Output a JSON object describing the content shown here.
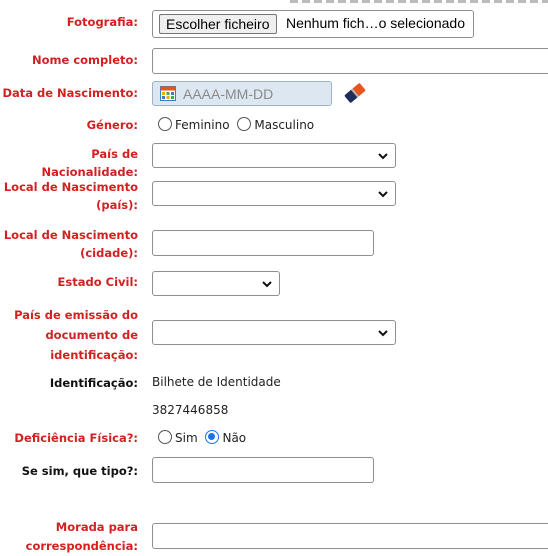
{
  "form": {
    "photo": {
      "label": "Fotografia:",
      "button": "Escolher ficheiro",
      "status": "Nenhum fich…o selecionado"
    },
    "full_name": {
      "label": "Nome completo:",
      "value": ""
    },
    "birth_date": {
      "label": "Data de Nascimento:",
      "placeholder": "AAAA-MM-DD",
      "clear_icon": "eraser-icon"
    },
    "gender": {
      "label": "Género:",
      "options": [
        "Feminino",
        "Masculino"
      ]
    },
    "nationality": {
      "label": "País de Nacionalidade:",
      "value": ""
    },
    "birth_country": {
      "label_line1": "Local de Nascimento",
      "label_line2": "(país):",
      "value": ""
    },
    "birth_city": {
      "label_line1": "Local de Nascimento",
      "label_line2": "(cidade):",
      "value": ""
    },
    "civil_status": {
      "label": "Estado Civil:",
      "value": ""
    },
    "id_country": {
      "label_line1": "País de emissão do",
      "label_line2": "documento de",
      "label_line3": "identificação:",
      "value": ""
    },
    "identification": {
      "label": "Identificação:",
      "type": "Bilhete de Identidade",
      "number": "3827446858"
    },
    "disability": {
      "label": "Deficiência Física?:",
      "options": [
        "Sim",
        "Não"
      ],
      "selected": "Não"
    },
    "disability_type": {
      "label": "Se sim, que tipo?:",
      "value": ""
    },
    "address": {
      "label_line1": "Morada para",
      "label_line2": "correspondência:",
      "value": ""
    }
  },
  "colors": {
    "label_red": "#d42020",
    "accent_blue": "#1a73e8",
    "date_bg": "#dde7f1"
  }
}
